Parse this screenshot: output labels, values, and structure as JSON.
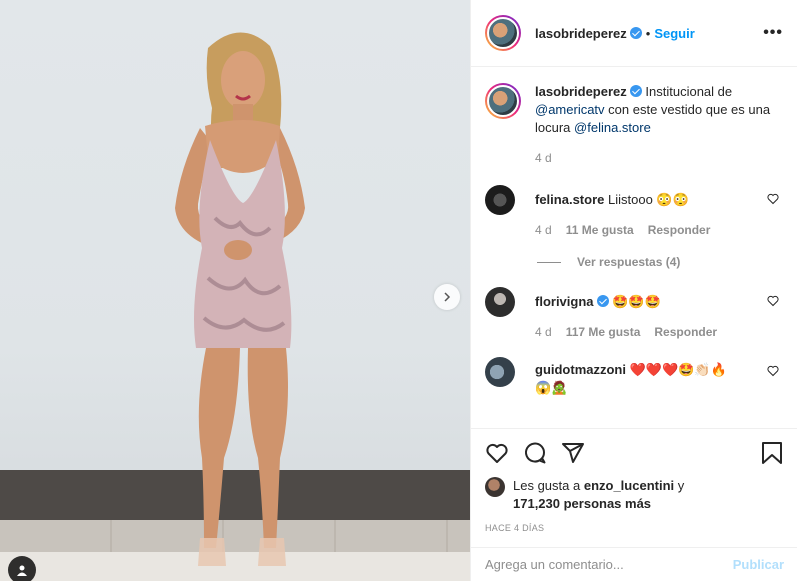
{
  "post": {
    "author": "lasobrideperez",
    "follow_label": "Seguir",
    "more_label": "•••",
    "caption_text": "Institucional de",
    "caption_mention_1": "@americatv",
    "caption_mid": "con este vestido que es una locura",
    "caption_mention_2": "@felina.store",
    "caption_age": "4 d"
  },
  "comments": [
    {
      "user": "felina.store",
      "text": "Liistooo 😳😳",
      "age": "4 d",
      "likes": "11 Me gusta",
      "reply": "Responder"
    },
    {
      "user": "florivigna",
      "text": "🤩🤩🤩",
      "age": "4 d",
      "likes": "117 Me gusta",
      "reply": "Responder"
    },
    {
      "user": "guidotmazzoni",
      "text": "❤️❤️❤️🤩👏🏻🔥",
      "text2": "😱🧟"
    }
  ],
  "replies_label": "Ver respuestas (4)",
  "likes": {
    "prefix": "Les gusta a",
    "user": "enzo_lucentini",
    "conj": "y",
    "count": "171,230 personas más"
  },
  "time_ago": "HACE 4 DÍAS",
  "comment_input": {
    "placeholder": "Agrega un comentario...",
    "publish": "Publicar"
  },
  "icons": [
    "heart-icon",
    "comment-icon",
    "share-icon",
    "bookmark-icon",
    "chevron-right-icon",
    "user-tag-icon",
    "verified-icon",
    "more-icon"
  ]
}
